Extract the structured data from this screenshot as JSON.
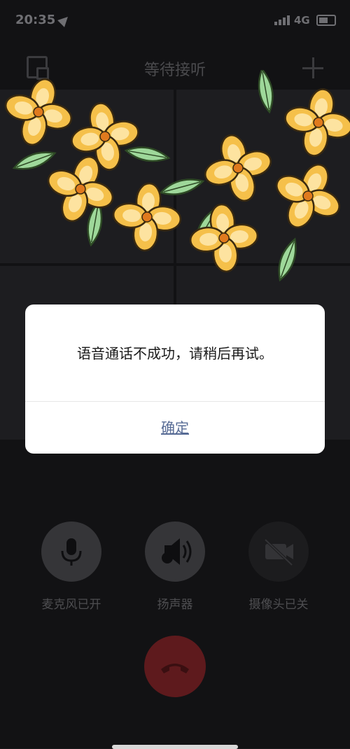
{
  "status_bar": {
    "time": "20:35",
    "network": "4G"
  },
  "call": {
    "title": "等待接听"
  },
  "controls": [
    {
      "label": "麦克风已开",
      "icon": "microphone-icon"
    },
    {
      "label": "扬声器",
      "icon": "speaker-icon"
    },
    {
      "label": "摄像头已关",
      "icon": "camera-off-icon"
    }
  ],
  "dialog": {
    "message": "语音通话不成功，请稍后再试。",
    "confirm_label": "确定"
  },
  "colors": {
    "link": "#576b95",
    "hangup": "#5e1a1d",
    "flower": "#f5c04a",
    "leaf": "#9ed89a"
  }
}
